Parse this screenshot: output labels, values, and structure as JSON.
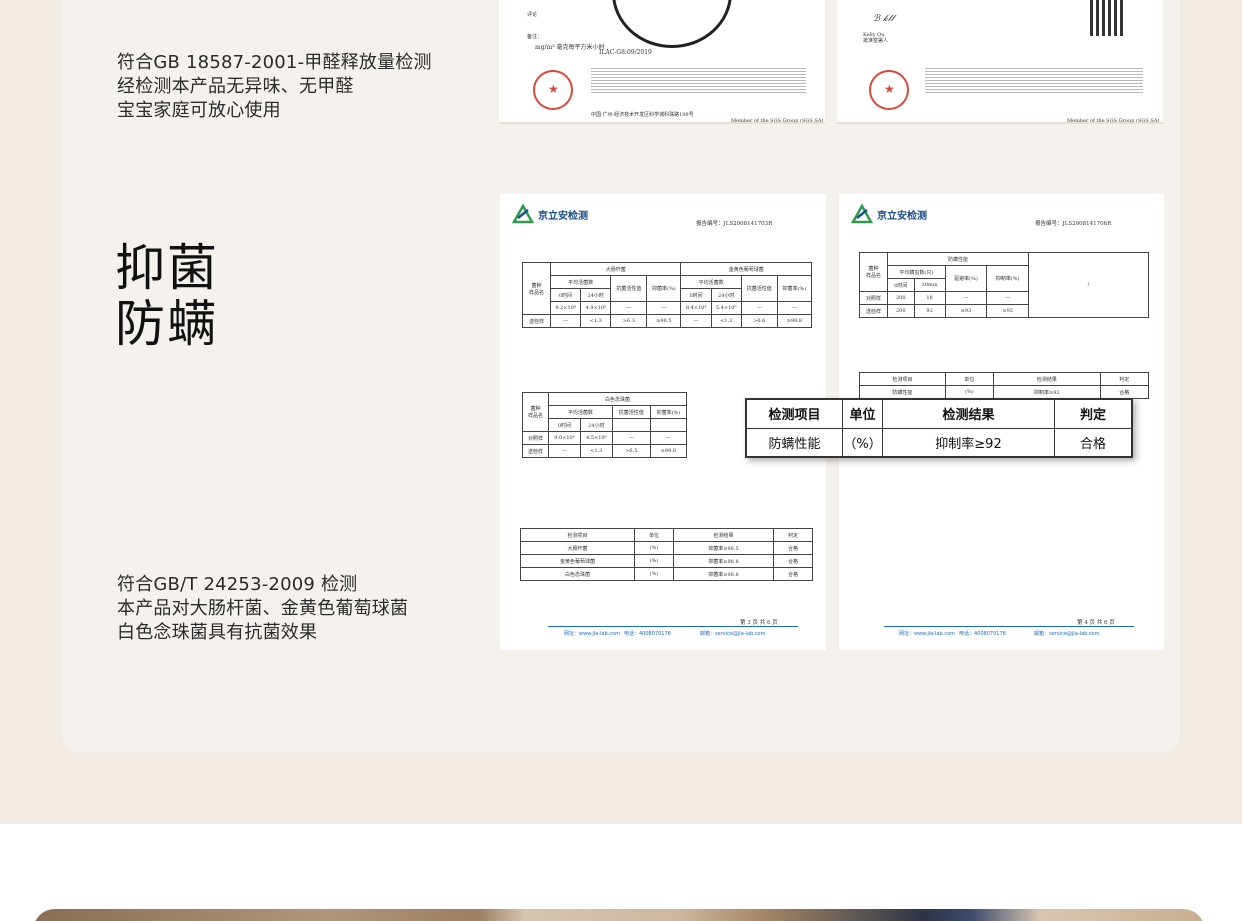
{
  "section_formaldehyde": {
    "lines": [
      "符合GB 18587-2001-甲醛释放量检测",
      "经检测本产品无异味、无甲醛",
      "宝宝家庭可放心使用"
    ]
  },
  "section_antibacterial": {
    "heading_line1": "抑菌",
    "heading_line2": "防螨",
    "lines": [
      "符合GB/T 24253-2009 检测",
      "本产品对大肠杆菌、金黄色葡萄球菌",
      "白色念珠菌具有抗菌效果"
    ]
  },
  "reports": {
    "lab_name": "京立安检测",
    "page3": "第 3 页 共 6 页",
    "page4": "第 4 页 共 6 页",
    "footer_website": "网址：www.jla-lab.com",
    "footer_phone": "电话：4008070178",
    "footer_email": "邮箱：service@jla-lab.com",
    "top_left_caption": "ILAC-G8:09/2019",
    "top_right_signature": "Kelly Ou",
    "sgs_member": "Member of the SGS Group (SGS SA)"
  },
  "mite_result": {
    "headers": [
      "检测项目",
      "单位",
      "检测结果",
      "判定"
    ],
    "row": [
      "防螨性能",
      "（%）",
      "抑制率≥92",
      "合格"
    ]
  },
  "colors": {
    "band": "#f2ebe3",
    "card": "#f5f1ec",
    "stamp_red": "#d64a3c",
    "lab_blue": "#1b4f8a"
  }
}
